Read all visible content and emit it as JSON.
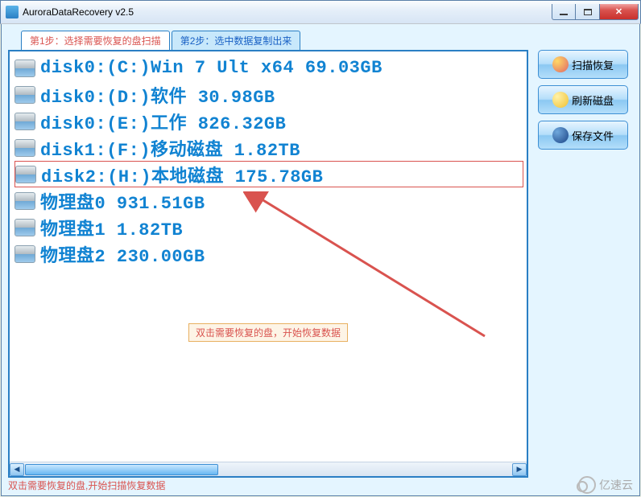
{
  "window": {
    "title": "AuroraDataRecovery v2.5"
  },
  "tabs": [
    {
      "label": "第1步：选择需要恢复的盘扫描",
      "active": true
    },
    {
      "label": "第2步：选中数据复制出来",
      "active": false
    }
  ],
  "disks": [
    {
      "label": "disk0:(C:)Win 7 Ult x64 69.03GB",
      "selected": false
    },
    {
      "label": "disk0:(D:)软件 30.98GB",
      "selected": false
    },
    {
      "label": "disk0:(E:)工作 826.32GB",
      "selected": false
    },
    {
      "label": "disk1:(F:)移动磁盘 1.82TB",
      "selected": false
    },
    {
      "label": "disk2:(H:)本地磁盘 175.78GB",
      "selected": true
    },
    {
      "label": "物理盘0 931.51GB",
      "selected": false
    },
    {
      "label": "物理盘1 1.82TB",
      "selected": false
    },
    {
      "label": "物理盘2 230.00GB",
      "selected": false
    }
  ],
  "hint": "双击需要恢复的盘，开始恢复数据",
  "sidebar_buttons": {
    "scan": "扫描恢复",
    "refresh": "刷新磁盘",
    "save": "保存文件"
  },
  "footer": "双击需要恢复的盘,开始扫描恢复数据",
  "watermark": "亿速云"
}
